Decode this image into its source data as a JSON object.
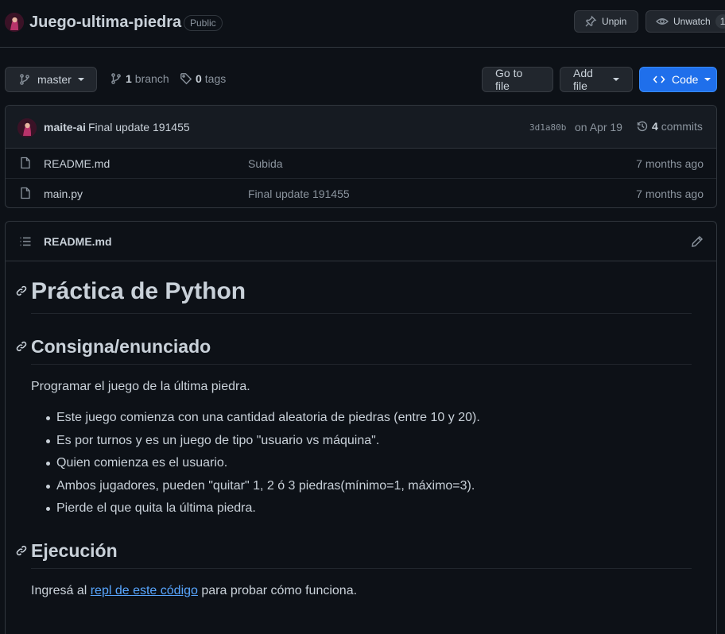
{
  "repo": {
    "name": "Juego-ultima-piedra",
    "visibility": "Public",
    "unpin_label": "Unpin",
    "unwatch_label": "Unwatch",
    "watch_count": "1"
  },
  "toolbar": {
    "branch_selected": "master",
    "branches_count": "1",
    "branches_label": "branch",
    "tags_count": "0",
    "tags_label": "tags",
    "go_to_file": "Go to file",
    "add_file": "Add file",
    "code": "Code"
  },
  "latest_commit": {
    "author": "maite-ai",
    "message": "Final update 191455",
    "sha": "3d1a80b",
    "date": "on Apr 19",
    "commits_count": "4",
    "commits_label": "commits"
  },
  "files": [
    {
      "name": "README.md",
      "message": "Subida",
      "age": "7 months ago",
      "icon": "file-icon"
    },
    {
      "name": "main.py",
      "message": "Final update 191455",
      "age": "7 months ago",
      "icon": "file-icon"
    }
  ],
  "readme": {
    "filename": "README.md",
    "h1": "Práctica de Python",
    "h2_consigna": "Consigna/enunciado",
    "intro": "Programar el juego de la última piedra.",
    "bullets": [
      "Este juego comienza con una cantidad aleatoria de piedras (entre 10 y 20).",
      "Es por turnos y es un juego de tipo \"usuario vs máquina\".",
      "Quien comienza es el usuario.",
      "Ambos jugadores, pueden \"quitar\" 1, 2 ó 3 piedras(mínimo=1, máximo=3).",
      "Pierde el que quita la última piedra."
    ],
    "h2_ejecucion": "Ejecución",
    "exec_prefix": "Ingresá al",
    "exec_link": "repl de este código",
    "exec_suffix": "para probar cómo funciona."
  },
  "colors": {
    "background": "#0d1117",
    "primary_button": "#1f6feb",
    "link": "#58a6ff",
    "border": "#30363d"
  }
}
